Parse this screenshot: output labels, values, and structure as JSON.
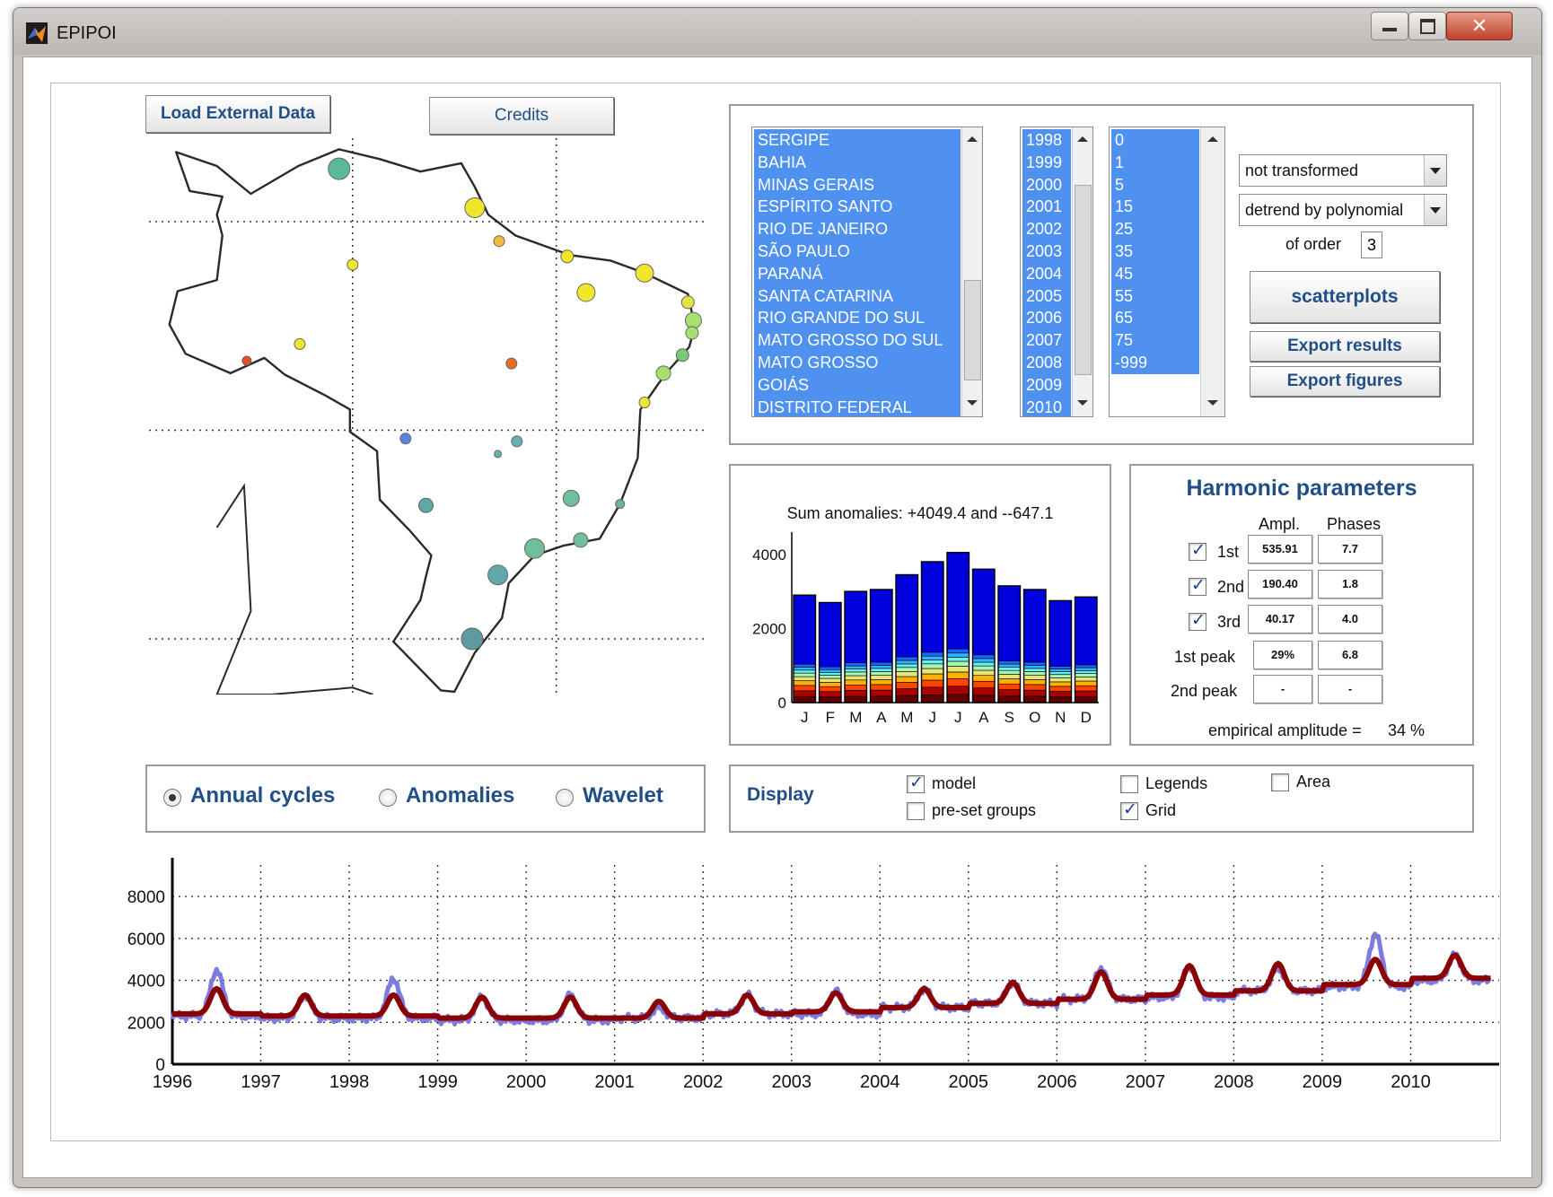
{
  "window": {
    "title": "EPIPOI"
  },
  "buttons": {
    "load_external": "Load External Data",
    "credits": "Credits",
    "scatterplots": "scatterplots",
    "export_results": "Export results",
    "export_figures": "Export figures"
  },
  "lists": {
    "regions": [
      "SERGIPE",
      "BAHIA",
      "MINAS GERAIS",
      "ESPÍRITO SANTO",
      "RIO DE JANEIRO",
      "SÃO PAULO",
      "PARANÁ",
      "SANTA CATARINA",
      "RIO GRANDE DO SUL",
      "MATO GROSSO DO SUL",
      "MATO GROSSO",
      "GOIÁS",
      "DISTRITO FEDERAL"
    ],
    "years": [
      "1998",
      "1999",
      "2000",
      "2001",
      "2002",
      "2003",
      "2004",
      "2005",
      "2006",
      "2007",
      "2008",
      "2009",
      "2010"
    ],
    "ages": [
      "0",
      "1",
      "5",
      "15",
      "25",
      "35",
      "45",
      "55",
      "65",
      "75",
      "-999"
    ]
  },
  "controls": {
    "transform_select": "not transformed",
    "detrend_select": "detrend by polynomial",
    "order_label": "of order",
    "order_value": "3"
  },
  "harmonic": {
    "title": "Harmonic parameters",
    "col_ampl": "Ampl.",
    "col_phases": "Phases",
    "rows": [
      {
        "label": "1st",
        "checked": true,
        "ampl": "535.91",
        "phase": "7.7"
      },
      {
        "label": "2nd",
        "checked": true,
        "ampl": "190.40",
        "phase": "1.8"
      },
      {
        "label": "3rd",
        "checked": true,
        "ampl": "40.17",
        "phase": "4.0"
      }
    ],
    "peaks": [
      {
        "label": "1st peak",
        "ampl": "29%",
        "phase": "6.8"
      },
      {
        "label": "2nd peak",
        "ampl": "-",
        "phase": "-"
      }
    ],
    "empirical_label": "empirical amplitude =",
    "empirical_value": "34 %"
  },
  "mode": {
    "options": [
      "Annual cycles",
      "Anomalies",
      "Wavelet"
    ],
    "selected": "Annual cycles"
  },
  "display": {
    "title": "Display",
    "options": [
      {
        "label": "model",
        "checked": true
      },
      {
        "label": "pre-set groups",
        "checked": false
      },
      {
        "label": "Legends",
        "checked": false
      },
      {
        "label": "Grid",
        "checked": true
      },
      {
        "label": "Area",
        "checked": false
      }
    ]
  },
  "chart_data": [
    {
      "type": "bar",
      "title": "Sum anomalies: +4049.4 and --647.1",
      "categories": [
        "J",
        "F",
        "M",
        "A",
        "M",
        "J",
        "J",
        "A",
        "S",
        "O",
        "N",
        "D"
      ],
      "values": [
        2900,
        2700,
        3000,
        3050,
        3450,
        3800,
        4050,
        3600,
        3150,
        3050,
        2750,
        2850
      ],
      "yticks": [
        0,
        2000,
        4000
      ],
      "ylim": [
        0,
        4600
      ],
      "stack_colors": [
        "#0000dd",
        "#1a66ff",
        "#33b3ff",
        "#66f0f0",
        "#a8f5b4",
        "#e6e676",
        "#ffb000",
        "#ff4400",
        "#aa0000",
        "#600000"
      ],
      "xlabel": "",
      "ylabel": ""
    },
    {
      "type": "line",
      "x_ticks": [
        "1996",
        "1997",
        "1998",
        "1999",
        "2000",
        "2001",
        "2002",
        "2003",
        "2004",
        "2005",
        "2006",
        "2007",
        "2008",
        "2009",
        "2010"
      ],
      "yticks": [
        0,
        2000,
        4000,
        6000,
        8000
      ],
      "xlim": [
        1996,
        2011
      ],
      "ylim": [
        0,
        9500
      ],
      "grid": true,
      "series": [
        {
          "color": "#7b7be0",
          "peak_years": [
            1996.5,
            1997.5,
            1998.5,
            1999.5,
            2000.5,
            2001.5,
            2002.5,
            2003.5,
            2004.5,
            2005.5,
            2006.5,
            2007.5,
            2008.5,
            2009.6,
            2010.5
          ],
          "peaks": [
            4500,
            3300,
            4100,
            3200,
            3300,
            2700,
            3300,
            3500,
            3600,
            3900,
            4600,
            4700,
            4600,
            6200,
            5200
          ],
          "troughs": [
            2300,
            2200,
            2200,
            2100,
            2100,
            2200,
            2400,
            2400,
            2700,
            2900,
            3100,
            3200,
            3500,
            3700,
            4000
          ]
        },
        {
          "color": "#8b0000",
          "peak_years": [
            1996.5,
            1997.5,
            1998.5,
            1999.5,
            2000.5,
            2001.5,
            2002.5,
            2003.5,
            2004.5,
            2005.5,
            2006.5,
            2007.5,
            2008.5,
            2009.6,
            2010.5
          ],
          "peaks": [
            3600,
            3300,
            3300,
            3200,
            3200,
            3000,
            3300,
            3400,
            3600,
            3900,
            4400,
            4700,
            4800,
            5000,
            5200
          ],
          "troughs": [
            2400,
            2300,
            2300,
            2200,
            2200,
            2200,
            2400,
            2500,
            2700,
            2900,
            3100,
            3300,
            3500,
            3800,
            4100
          ]
        }
      ]
    }
  ],
  "map": {
    "points": [
      {
        "lon": -61.0,
        "lat": 3.8,
        "r": 12,
        "color": "#5cb89a"
      },
      {
        "lon": -51.0,
        "lat": 1.0,
        "r": 11,
        "color": "#f2e62a"
      },
      {
        "lon": -49.2,
        "lat": -1.4,
        "r": 6,
        "color": "#f5b93a"
      },
      {
        "lon": -60.0,
        "lat": -3.1,
        "r": 6,
        "color": "#f2e62a"
      },
      {
        "lon": -44.2,
        "lat": -2.5,
        "r": 7,
        "color": "#f2e62a"
      },
      {
        "lon": -42.8,
        "lat": -5.1,
        "r": 10,
        "color": "#f2e62a"
      },
      {
        "lon": -38.5,
        "lat": -3.7,
        "r": 10,
        "color": "#f2e62a"
      },
      {
        "lon": -35.3,
        "lat": -5.8,
        "r": 7,
        "color": "#e0e440"
      },
      {
        "lon": -34.9,
        "lat": -7.1,
        "r": 9,
        "color": "#a8e070"
      },
      {
        "lon": -35.0,
        "lat": -8.0,
        "r": 7,
        "color": "#a8e070"
      },
      {
        "lon": -35.7,
        "lat": -9.6,
        "r": 7,
        "color": "#7cc87a"
      },
      {
        "lon": -37.1,
        "lat": -10.9,
        "r": 8,
        "color": "#a8e070"
      },
      {
        "lon": -38.5,
        "lat": -13.0,
        "r": 6,
        "color": "#f2e62a"
      },
      {
        "lon": -63.9,
        "lat": -8.8,
        "r": 6,
        "color": "#f2e62a"
      },
      {
        "lon": -67.8,
        "lat": -10.0,
        "r": 5,
        "color": "#e84a2a"
      },
      {
        "lon": -48.3,
        "lat": -10.2,
        "r": 6,
        "color": "#e86a2a"
      },
      {
        "lon": -56.1,
        "lat": -15.6,
        "r": 6,
        "color": "#5a86e0"
      },
      {
        "lon": -47.9,
        "lat": -15.8,
        "r": 6,
        "color": "#66b0b0"
      },
      {
        "lon": -49.3,
        "lat": -16.7,
        "r": 4,
        "color": "#66b0b0"
      },
      {
        "lon": -40.3,
        "lat": -20.3,
        "r": 5,
        "color": "#6ab0a8"
      },
      {
        "lon": -43.9,
        "lat": -19.9,
        "r": 9,
        "color": "#6fbf9a"
      },
      {
        "lon": -54.6,
        "lat": -20.4,
        "r": 8,
        "color": "#5fa8a8"
      },
      {
        "lon": -43.2,
        "lat": -22.9,
        "r": 8,
        "color": "#6fbf9a"
      },
      {
        "lon": -46.6,
        "lat": -23.5,
        "r": 11,
        "color": "#6fbf9a"
      },
      {
        "lon": -49.3,
        "lat": -25.4,
        "r": 11,
        "color": "#5fa8a8"
      },
      {
        "lon": -51.2,
        "lat": -30.0,
        "r": 12,
        "color": "#5f9aa0"
      }
    ]
  }
}
